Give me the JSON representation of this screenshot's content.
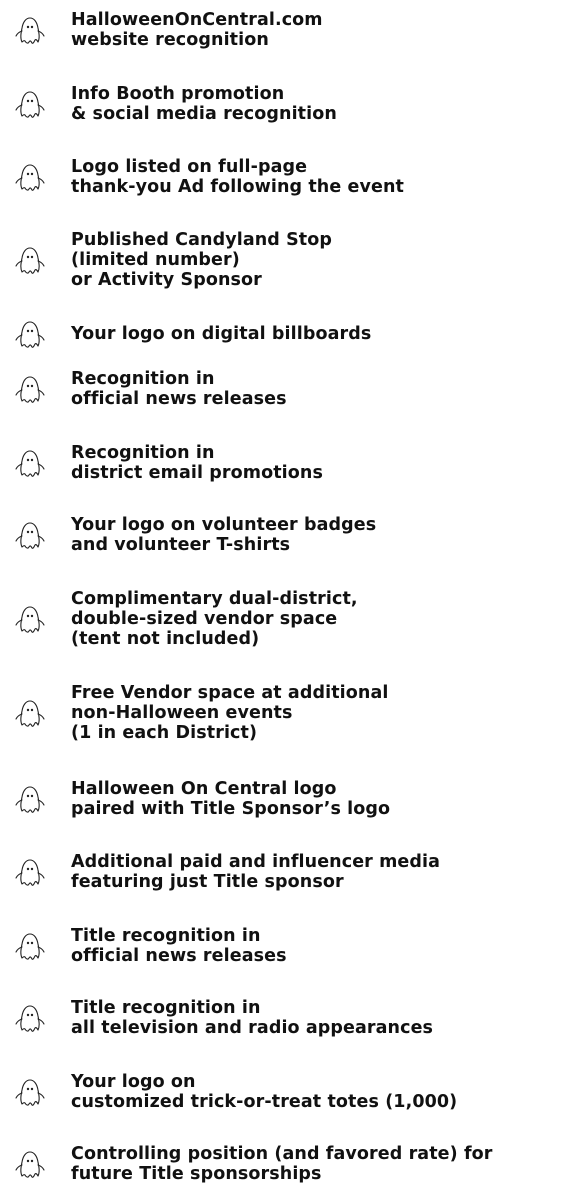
{
  "icon": "ghost-icon",
  "text_color": "#111111",
  "items": [
    {
      "text": "HalloweenOnCentral.com\nwebsite recognition"
    },
    {
      "text": "Info Booth promotion\n& social media recognition"
    },
    {
      "text": "Logo listed on full-page\nthank-you Ad following the event"
    },
    {
      "text": "Published Candyland Stop\n(limited number)\nor Activity Sponsor"
    },
    {
      "text": "Your logo on digital billboards"
    },
    {
      "text": "Recognition in\nofficial news releases"
    },
    {
      "text": "Recognition in\ndistrict email promotions"
    },
    {
      "text": "Your logo on volunteer badges\nand volunteer T-shirts"
    },
    {
      "text": "Complimentary dual-district,\ndouble-sized vendor space\n(tent not included)"
    },
    {
      "text": "Free Vendor space at additional\nnon-Halloween events\n(1 in each District)"
    },
    {
      "text": "Halloween On Central logo\npaired with Title Sponsor’s logo"
    },
    {
      "text": "Additional paid and influencer media\nfeaturing just Title sponsor"
    },
    {
      "text": "Title recognition in\nofficial news releases"
    },
    {
      "text": "Title recognition in\nall television and radio appearances"
    },
    {
      "text": "Your logo on\ncustomized trick-or-treat totes (1,000)"
    },
    {
      "text": "Controlling position (and favored rate) for\nfuture Title sponsorships"
    }
  ]
}
